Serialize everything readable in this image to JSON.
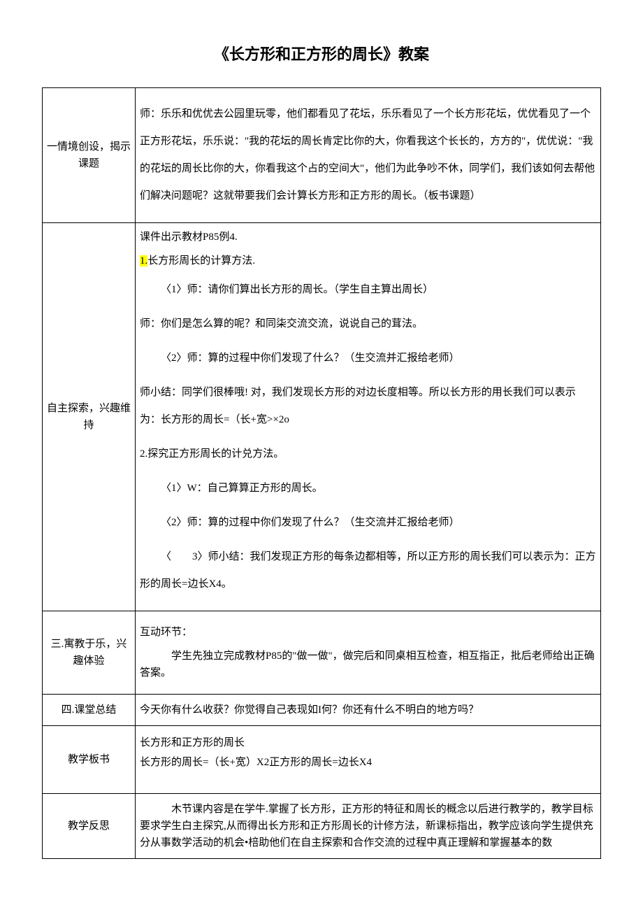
{
  "title": "《长方形和正方形的周长》教案",
  "rows": {
    "r1": {
      "label": "一情境创设，揭示课题",
      "p1": "师：乐乐和优优去公园里玩零，他们都看见了花坛，乐乐看见了一个长方形花坛，优优看见了一个正方形花坛，乐乐说：\"我的花坛的周长肯定比你的大，你看我这个长长的，方方的\"，优优说：\"我的花坛的周长比你的大，你看我这个占的空间大\"，他们为此争吵不休，同学们，我们该如何去帮他们解决问题呢？这就带要我们会计算长方形和正方形的周长。（板书课题）"
    },
    "r2": {
      "label": "自主探索，兴趣维持",
      "p1": "课件出示教材P85例4.",
      "p2a": "1.",
      "p2b": "长方形周长的计算方法.",
      "p3": "〈1〉师：请你们算出长方形的周长。（学生自主算出周长）",
      "p4": "师：你们是怎么算的呢？和同柒交流交流，说说自己的茸法。",
      "p5": "〈2〉师：算的过程中你们发现了什么？（生交流并汇报给老师）",
      "p6": "师小结：同学们很棒哦! 对，我们发现长方形的对边长度相等。所以长方形的用长我们可以表示为：长方形的周长=（长+宽>×2o",
      "p7": "2.探究正方形周长的计兑方法。",
      "p8": "〈1〉W：自己算算正方形的周长。",
      "p9": "〈2〉师：算的过程中你们发现了什么？（生交流并汇报给老师）",
      "p10": "〈　　3〉师小结：我们发现正方形的每条边都相等，所以正方形的周长我们可以表示为：正方形的周长=边长X4。"
    },
    "r3": {
      "label": "三.寓教于乐，兴趣体验",
      "p1": "互动环节：",
      "p2": "学生先独立完成教材P85的\"做一做\"，做完后和同桌相互检查，相互指正，批后老师给出正确答案。"
    },
    "r4": {
      "label": "四.课堂总结",
      "p1": "今天你有什么收获？你觉得自己表现如I何？你还有什么不明白的地方吗？"
    },
    "r5": {
      "label": "教学板书",
      "p1": "长方形和正方形的周长",
      "p2": "长方形的周长=（长+宽）X2正方形的周长=边长X4"
    },
    "r6": {
      "label": "教学反思",
      "p1": "木节课内容是在学牛.掌握了长方形，正方形的特征和周长的概念以后进行教学的，教学目标要求学生白主探究,从而得出长方形和正方形周长的计修方法，新课标指出，教学应该向学生提供充分从事数学活动的机会•棓助他们在自主探索和合作交流的过程中真正理解和掌握基本的数"
    }
  }
}
